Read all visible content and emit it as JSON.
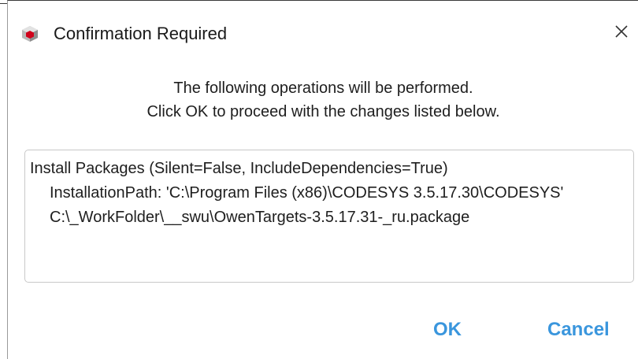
{
  "window": {
    "title": "Confirmation Required",
    "icon": "codesys-cube-icon",
    "close_icon": "close-icon"
  },
  "message": {
    "line1": "The following operations will be performed.",
    "line2": "Click OK to proceed with the changes listed below."
  },
  "changes": {
    "line1": "Install Packages (Silent=False, IncludeDependencies=True)",
    "line2": "InstallationPath: 'C:\\Program Files (x86)\\CODESYS 3.5.17.30\\CODESYS'",
    "line3": "C:\\_WorkFolder\\__swu\\OwenTargets-3.5.17.31-_ru.package"
  },
  "buttons": {
    "ok_label": "OK",
    "cancel_label": "Cancel"
  },
  "colors": {
    "accent": "#3a96dd",
    "icon_red": "#d0021b"
  }
}
